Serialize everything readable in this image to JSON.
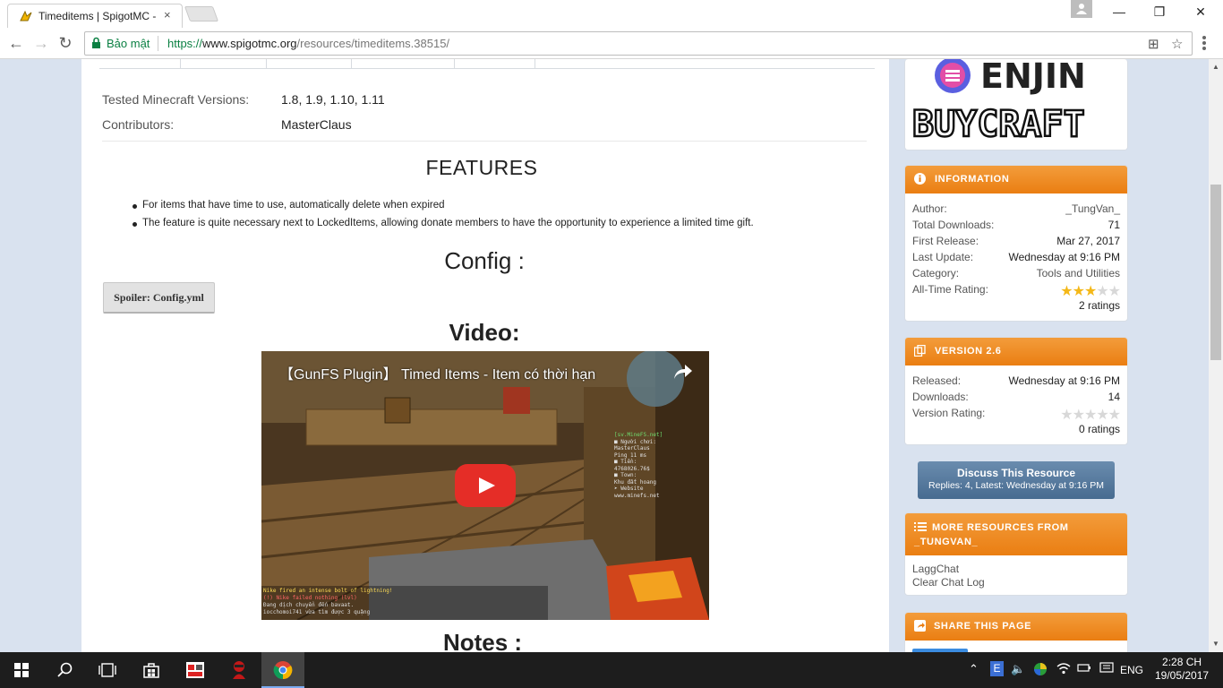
{
  "browser": {
    "tab_title": "Timeditems | SpigotMC -",
    "tab_close": "×",
    "secure_label": "Bảo mật",
    "url_scheme": "https://",
    "url_host": "www.spigotmc.org",
    "url_path": "/resources/timeditems.38515/",
    "win_minimize": "—",
    "win_restore": "❐",
    "win_close": "✕"
  },
  "resource": {
    "tested_versions_label": "Tested Minecraft Versions:",
    "tested_versions_value": "1.8, 1.9, 1.10, 1.11",
    "contributors_label": "Contributors:",
    "contributors_value": "MasterClaus",
    "features_title": "FEATURES",
    "features": [
      "For items that have time to use, automatically delete when expired",
      "The feature is quite necessary next to LockedItems, allowing donate members to have the opportunity to experience a limited time gift."
    ],
    "config_title": "Config :",
    "spoiler_label": "Spoiler: Config.yml",
    "video_title": "Video:",
    "video_caption": "【GunFS Plugin】 Timed Items - Item có thời hạn",
    "notes_title": "Notes :"
  },
  "sidebar": {
    "information": {
      "title": "INFORMATION",
      "rows": [
        {
          "k": "Author:",
          "v": "_TungVan_"
        },
        {
          "k": "Total Downloads:",
          "v": "71"
        },
        {
          "k": "First Release:",
          "v": "Mar 27, 2017"
        },
        {
          "k": "Last Update:",
          "v": "Wednesday at 9:16 PM"
        },
        {
          "k": "Category:",
          "v": "Tools and Utilities"
        }
      ],
      "rating_label": "All-Time Rating:",
      "rating": 3,
      "rating_count": "2 ratings"
    },
    "version": {
      "title": "VERSION 2.6",
      "rows": [
        {
          "k": "Released:",
          "v": "Wednesday at 9:16 PM"
        },
        {
          "k": "Downloads:",
          "v": "14"
        }
      ],
      "rating_label": "Version Rating:",
      "rating": 0,
      "rating_count": "0 ratings"
    },
    "discuss": {
      "title": "Discuss This Resource",
      "subtitle": "Replies: 4, Latest: Wednesday at 9:16 PM"
    },
    "more": {
      "title_line1": "MORE RESOURCES FROM",
      "title_line2": "_TUNGVAN_",
      "items": [
        "LaggChat",
        "Clear Chat Log"
      ]
    },
    "share": {
      "title": "SHARE THIS PAGE"
    },
    "ad": {
      "line1": "ENJIN",
      "line2": "BUYCRAFT"
    }
  },
  "taskbar": {
    "lang": "ENG",
    "time": "2:28 CH",
    "date": "19/05/2017"
  },
  "colors": {
    "accent_orange": "#ea7e12",
    "discuss_blue": "#476b90",
    "secure_green": "#0b8043",
    "page_bg": "#d9e2ef"
  }
}
